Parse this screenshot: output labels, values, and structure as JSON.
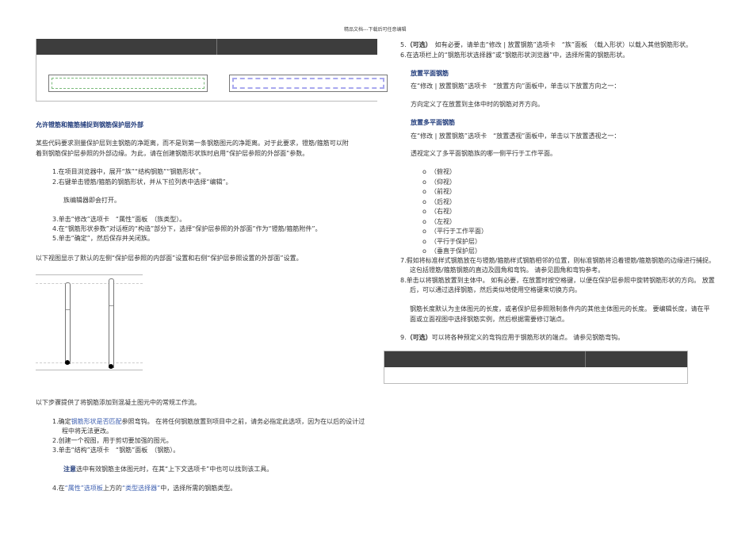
{
  "header": {
    "watermark": "精品文档---下载后可任意编辑"
  },
  "left": {
    "heading": "允许镫筋和箍筋捕捉到钢筋保护层外部",
    "para1": [
      "某些代码要求测量保护层到主钢筋的净距离，而不是到第一条钢筋图元的净距离。对于此要求，镫筋/箍筋可以附",
      "着到钢筋保护层参照的外部边缘。为此，请在创建钢筋形状族时启用“保护层参照的外部面”参数。"
    ],
    "steps1": [
      {
        "num": "1.",
        "text": "在项目浏览器中，展开“族”“结构钢筋”“钢筋形状”。"
      },
      {
        "num": "2.",
        "text": "右键单击镫筋/箍筋的钢筋形状，并从下拉列表中选择“编辑”。"
      }
    ],
    "sub1": "族编辑器即会打开。",
    "steps2": [
      {
        "num": "3.",
        "text": "单击“修改”选项卡　“属性”面板　（族类型）。"
      },
      {
        "num": "4.",
        "text": "在“钢筋形状参数”对话框的“构造”部分下，选择“保护层参照的外部面”作为“镫筋/箍筋附件”。"
      },
      {
        "num": "5.",
        "text": "单击“确定”，然后保存并关闭族。"
      }
    ],
    "para2": "以下视图显示了默认的左侧“保护层参照的内部面”设置和右侧“保护层参照设置的外部面”设置。",
    "para3": "以下步骤提供了将钢筋添加到混凝土图元中的常规工作流。",
    "wf1": {
      "num": "1.",
      "pre": "确定",
      "link": "钢筋形状是否匹配",
      "post": "参照弯钩。 在将任何钢筋放置到项目中之前，请务必指定此选项，因为在以后的设计过",
      "cont": "程中将无法更改。"
    },
    "wf2": {
      "num": "2.",
      "text": "创建一个视图，用于剪切要加强的图元。"
    },
    "wf3": {
      "num": "3.",
      "text": "单击“结构”选项卡　“钢筋”面板　（钢筋）。"
    },
    "note": {
      "label": "注意",
      "text": "选中有效钢筋主体图元时，在其“上下文选项卡”中也可以找到该工具。"
    },
    "wf4": {
      "num": "4.",
      "pre": "在",
      "link1": "“属性”选项板",
      "mid": "上方的",
      "link2": "“类型选择器”",
      "post": "中，选择所需的钢筋类型。"
    }
  },
  "right": {
    "s5": {
      "num": "5.",
      "opt": "（可选）",
      "text": "　如有必要，请单击“修改 | 放置钢筋”选项卡　“族”面板　（载入形状）以载入其他钢筋形状。"
    },
    "s6": {
      "num": "6.",
      "text": "在选项栏上的“钢筋形状选择器”或“钢筋形状浏览器”中，选择所需的钢筋形状。"
    },
    "plane_heading": "放置平面钢筋",
    "plane_text1": "在“修改 | 放置钢筋”选项卡　“放置方向”面板中，单击以下放置方向之一：",
    "plane_text2": "方向定义了在放置到主体中时的钢筋对齐方向。",
    "multi_heading": "放置多平面钢筋",
    "multi_text1": "在“修改 | 放置钢筋”选项卡　“放置透视”面板中，单击以下放置透视之一：",
    "multi_text2": "透视定义了多平面钢筋族的哪一侧平行于工作平面。",
    "bullet": "o",
    "views": [
      "（俯视）",
      "（仰视）",
      "（前视）",
      "（后视）",
      "（右视）",
      "（左视）",
      "（平行于工作平面）",
      "（平行于保护层）",
      "（垂直于保护层）"
    ],
    "s7": {
      "num": "7.",
      "lines": [
        "假如将标准样式钢筋放在与镫筋/箍筋样式钢筋相邻的位置，则标准钢筋将沿着镫筋/箍筋钢筋的边缘进行捕捉。",
        "这包括镫筋/箍筋钢筋的直边及圆角和弯钩。 请参见圆角和弯钩参考。"
      ]
    },
    "s8": {
      "num": "8.",
      "lines": [
        "单击以将钢筋放置到主体中。 如有必要，在放置时按空格键，以便在保护层参照中旋转钢筋形状的方向。 放置",
        "后，可以通过选择钢筋，然后类似地使用空格键来切换方向。"
      ]
    },
    "s8_para": [
      "钢筋长度默认为主体图元的长度，或者保护层参照限制条件内的其他主体图元的长度。 要编辑长度，请在平",
      "面或立面视图中选择钢筋实例，然后根据需要修订端点。"
    ],
    "s9": {
      "num": "9.",
      "opt": "（可选）",
      "text": "可以将各种预定义的弯钩应用于钢筋形状的端点。 请参见钢筋弯钩。"
    }
  }
}
